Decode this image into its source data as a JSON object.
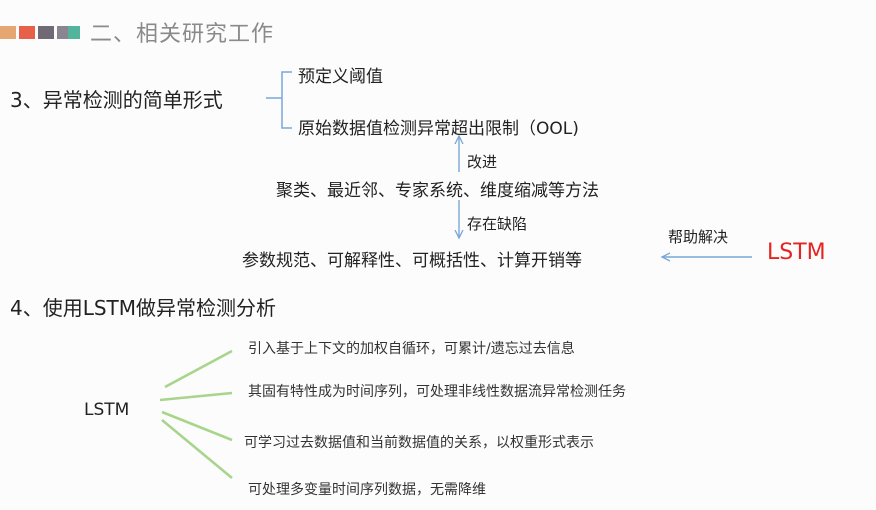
{
  "header": {
    "colors": [
      "#e6a672",
      "#e7604a",
      "#6f6a73",
      "#8c8591",
      "#52b49a"
    ],
    "title": "二、相关研究工作"
  },
  "section3": {
    "title": "3、异常检测的简单形式",
    "branch_1": "预定义阈值",
    "branch_2": "原始数据值检测异常超出限制（OOL)",
    "improve_label": "改进",
    "methods": "聚类、最近邻、专家系统、维度缩减等方法",
    "defect_label": "存在缺陷",
    "problems": "参数规范、可解释性、可概括性、计算开销等",
    "help_label": "帮助解决",
    "lstm": "LSTM"
  },
  "section4": {
    "title": "4、使用LSTM做异常检测分析",
    "root": "LSTM",
    "branches": [
      "引入基于上下文的加权自循环，可累计/遗忘过去信息",
      "其固有特性成为时间序列，可处理非线性数据流异常检测任务",
      "可学习过去数据值和当前数据值的关系，以权重形式表示",
      "可处理多变量时间序列数据，无需降维"
    ]
  },
  "colors": {
    "accent_red": "#e52421",
    "arrow_blue": "#7aa6d8",
    "branch_green": "#a8d58b"
  }
}
